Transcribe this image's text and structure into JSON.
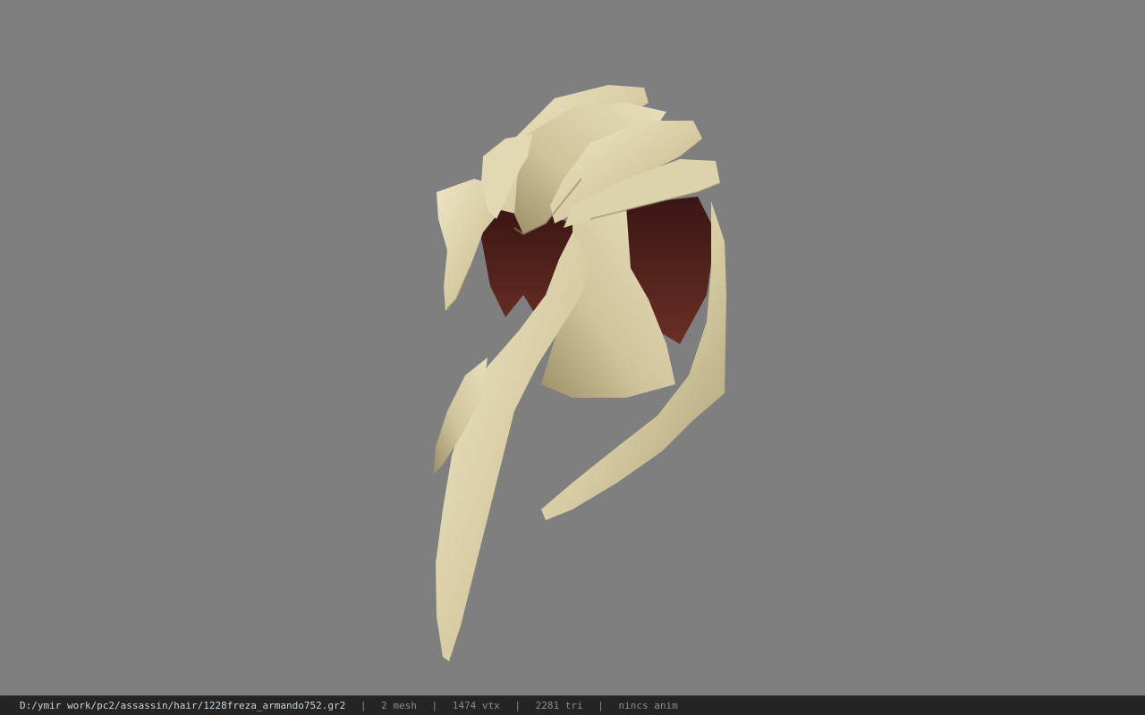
{
  "viewer": {
    "background_color": "#7f7f7f",
    "model": {
      "name": "hair-model",
      "hair_color": "#d9cfa7",
      "inner_color": "#4a1f1a"
    }
  },
  "statusbar": {
    "file_path": "D:/ymir work/pc2/assassin/hair/1228freza_armando752.gr2",
    "separator": "|",
    "mesh_count": "2 mesh",
    "vertex_count": "1474 vtx",
    "triangle_count": "2281 tri",
    "anim_status": "nincs anim"
  }
}
